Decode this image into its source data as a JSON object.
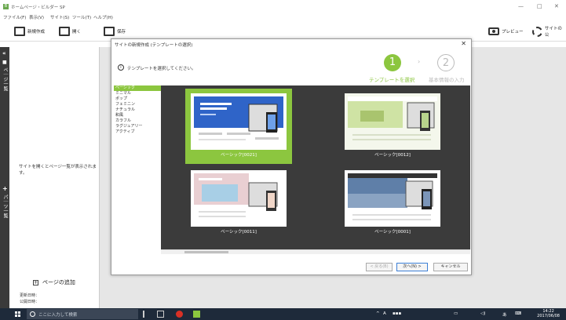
{
  "window": {
    "title": "ホームページ・ビルダー SP"
  },
  "menu": [
    "ファイル(F)",
    "表示(V)",
    "サイト(S)",
    "ツール(T)",
    "ヘルプ(H)"
  ],
  "toolbar": {
    "new_label": "新規作成",
    "open_label": "開く",
    "save_label": "保存",
    "preview_label": "プレビュー",
    "site_label": "サイトの公"
  },
  "left_panel": {
    "tab_pages": "ペ｜ジ一覧",
    "tab_parts": "パ｜ツ一覧",
    "message": "サイトを開くとページ一覧が表示されます。",
    "add_page": "ページの追加",
    "updated": "更新日時：",
    "published": "公開日時："
  },
  "dialog": {
    "title": "サイトの新規作成 (テンプレートの選択)",
    "info": "テンプレートを選択してください。",
    "step1_num": "1",
    "step1_label": "テンプレートを選択",
    "step2_num": "2",
    "step2_label": "基本情報の入力",
    "categories": [
      "ベーシック",
      "ミニマル",
      "ポップ",
      "フェミニン",
      "ナチュラル",
      "和風",
      "カラフル",
      "ラグジュアリー",
      "アクティブ"
    ],
    "templates": [
      {
        "name": "ベーシック[0021]",
        "selected": true
      },
      {
        "name": "ベーシック[0012]",
        "selected": false
      },
      {
        "name": "ベーシック[0011]",
        "selected": false
      },
      {
        "name": "ベーシック[0001]",
        "selected": false
      }
    ],
    "back_label": "< 戻る(B)",
    "next_label": "次へ(N) >",
    "cancel_label": "キャンセル"
  },
  "taskbar": {
    "search_placeholder": "ここに入力して検索",
    "tray": "A",
    "time": "14:22",
    "date": "2017/06/08"
  }
}
